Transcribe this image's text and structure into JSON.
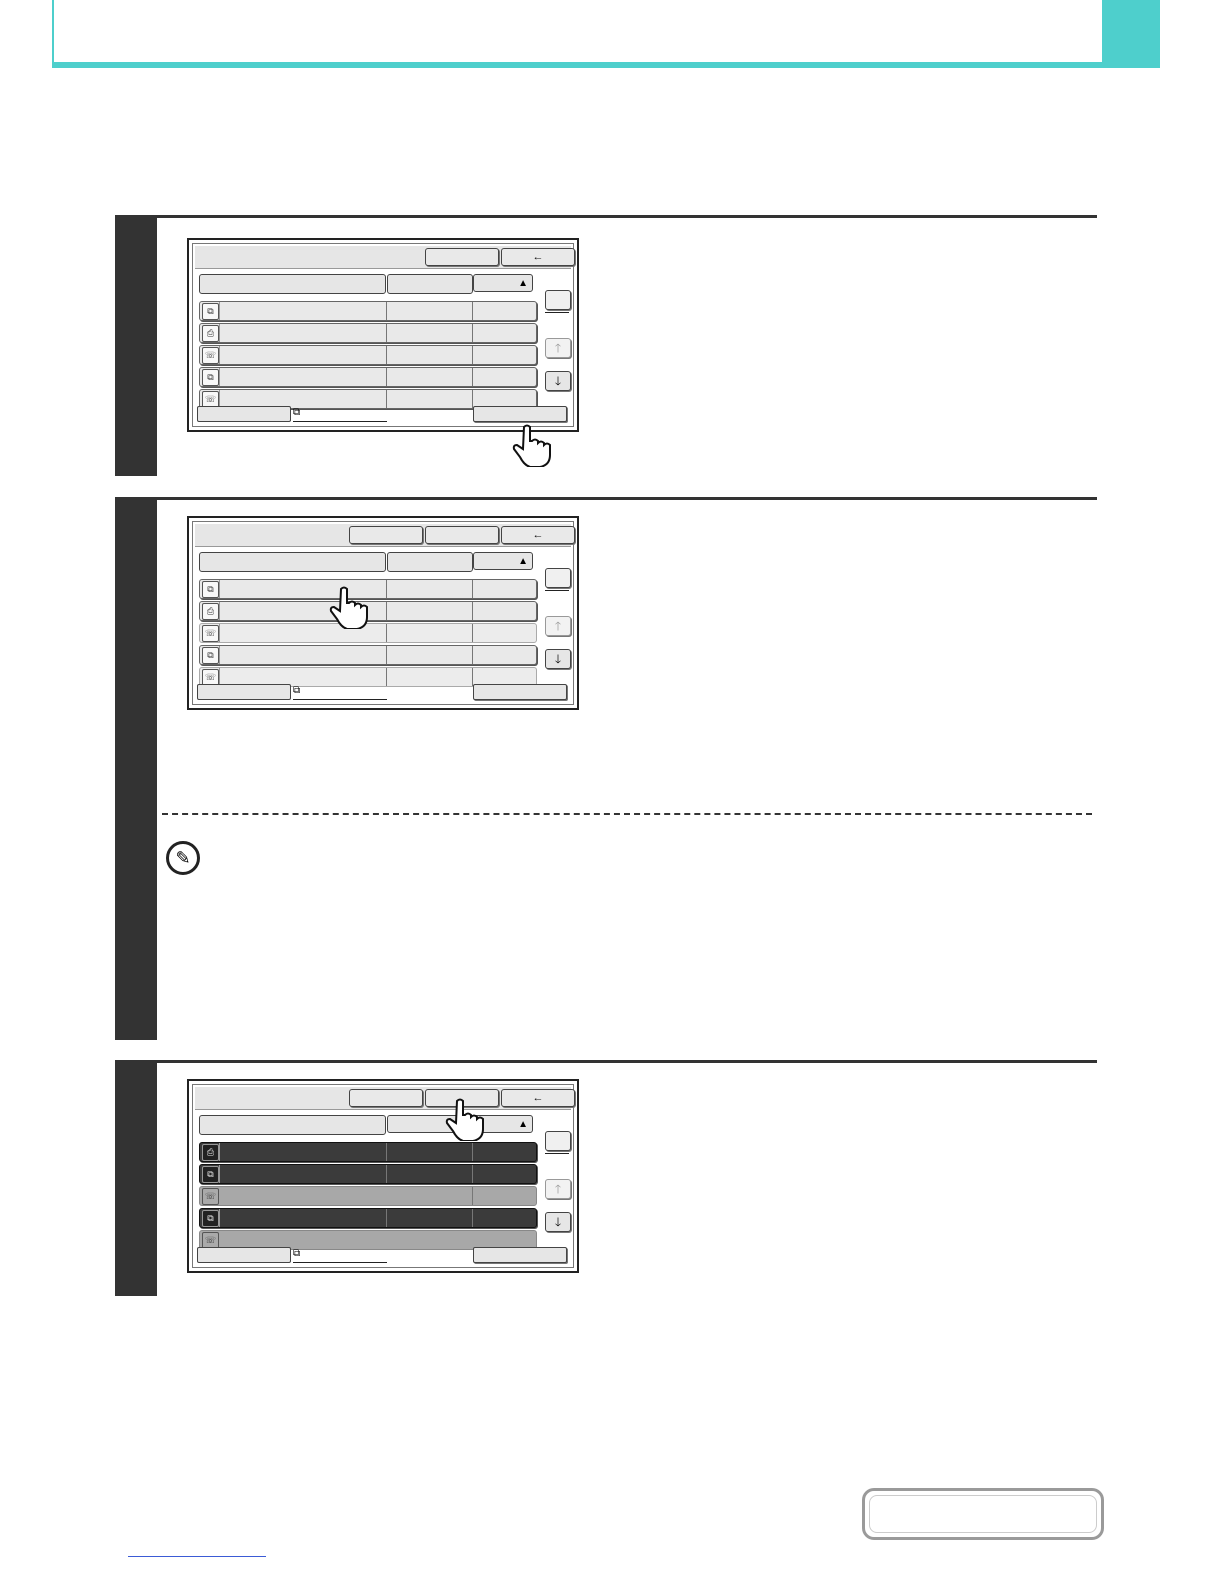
{
  "page": {
    "accent_color": "#4ecfcc",
    "step_bar_color": "#333333"
  },
  "screens": [
    {
      "id": "screen-1",
      "title_buttons": [
        "",
        "←"
      ],
      "column_header_sort_glyph": "▲",
      "rows": [
        {
          "icon": "copy-icon",
          "style": "normal"
        },
        {
          "icon": "scan-icon",
          "style": "normal"
        },
        {
          "icon": "fax-icon",
          "style": "normal"
        },
        {
          "icon": "copy-icon",
          "style": "normal"
        },
        {
          "icon": "fax-icon",
          "style": "normal"
        }
      ],
      "side": {
        "up": "🡑",
        "down": "🡓"
      },
      "pointer_target": "footer-right-button"
    },
    {
      "id": "screen-2",
      "title_buttons": [
        "",
        "",
        "←"
      ],
      "column_header_sort_glyph": "▲",
      "rows": [
        {
          "icon": "copy-icon",
          "style": "normal"
        },
        {
          "icon": "scan-icon",
          "style": "normal"
        },
        {
          "icon": "fax-icon",
          "style": "light"
        },
        {
          "icon": "copy-icon",
          "style": "normal"
        },
        {
          "icon": "fax-icon",
          "style": "light"
        }
      ],
      "side": {
        "up": "🡑",
        "down": "🡓"
      },
      "pointer_target": "first-row"
    },
    {
      "id": "screen-3",
      "title_buttons": [
        "",
        "",
        "←"
      ],
      "column_header_sort_glyph": "▲",
      "rows": [
        {
          "icon": "scan-icon",
          "style": "dark"
        },
        {
          "icon": "copy-icon",
          "style": "dark"
        },
        {
          "icon": "fax-icon",
          "style": "grey"
        },
        {
          "icon": "copy-icon",
          "style": "dark"
        },
        {
          "icon": "fax-icon",
          "style": "grey"
        }
      ],
      "side": {
        "up": "🡑",
        "down": "🡓"
      },
      "pointer_target": "title-middle-button"
    }
  ],
  "note": {
    "icon": "pencil-note-icon"
  },
  "contents_button": {
    "label": ""
  }
}
